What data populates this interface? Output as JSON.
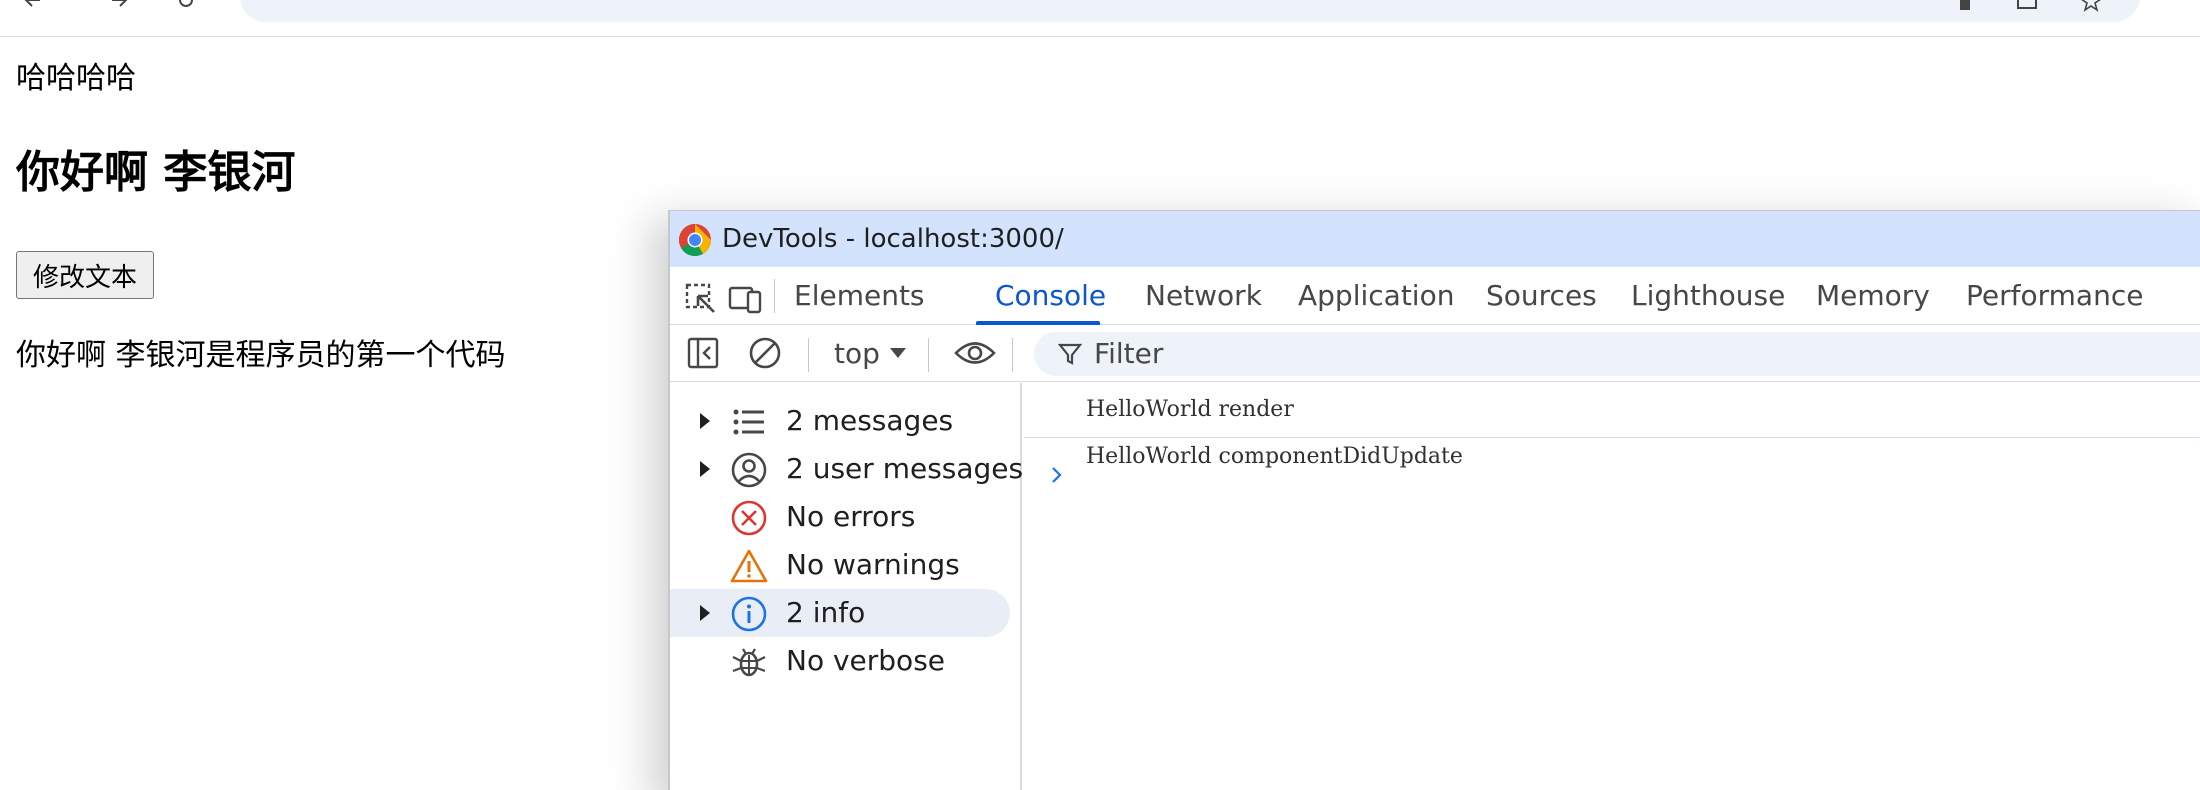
{
  "page": {
    "line1": "哈哈哈哈",
    "heading": "你好啊 李银河",
    "button_label": "修改文本",
    "paragraph": "你好啊 李银河是程序员的第一个代码"
  },
  "devtools": {
    "title": "DevTools - localhost:3000/",
    "tabs": [
      {
        "label": "Elements"
      },
      {
        "label": "Console"
      },
      {
        "label": "Network"
      },
      {
        "label": "Application"
      },
      {
        "label": "Sources"
      },
      {
        "label": "Lighthouse"
      },
      {
        "label": "Memory"
      },
      {
        "label": "Performance"
      }
    ],
    "active_tab": "Console",
    "context": "top",
    "filter_placeholder": "Filter",
    "sidebar": [
      {
        "label": "2 messages",
        "icon": "list-icon"
      },
      {
        "label": "2 user messages",
        "icon": "user-icon"
      },
      {
        "label": "No errors",
        "icon": "error-icon"
      },
      {
        "label": "No warnings",
        "icon": "warning-icon"
      },
      {
        "label": "2 info",
        "icon": "info-icon"
      },
      {
        "label": "No verbose",
        "icon": "bug-icon"
      }
    ],
    "console_lines": [
      "HelloWorld render",
      "HelloWorld componentDidUpdate"
    ],
    "colors": {
      "accent": "#0b57d0",
      "titlebar": "#d3e3fd",
      "error": "#dc362e",
      "warning": "#e8710a",
      "info": "#1a73e8"
    }
  }
}
